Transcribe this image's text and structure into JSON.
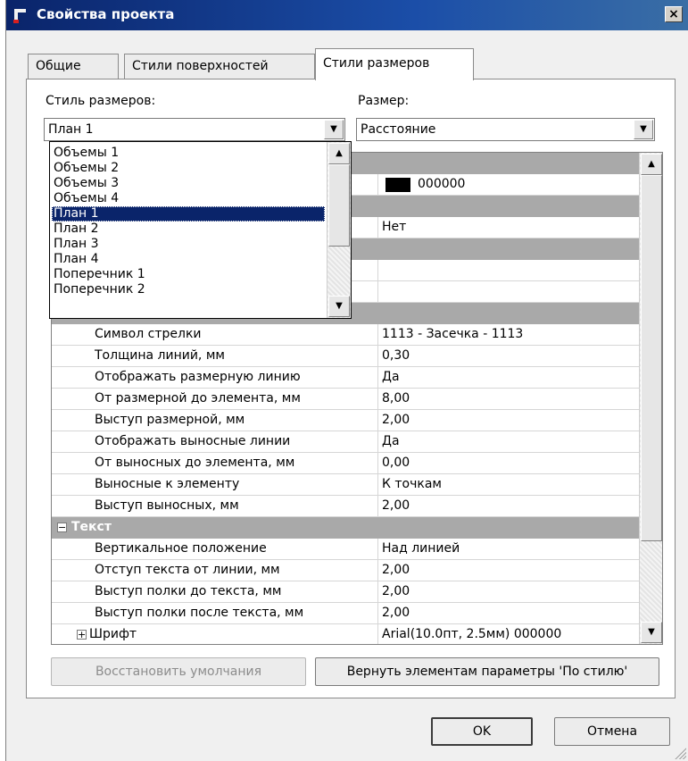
{
  "window": {
    "title": "Свойства проекта",
    "close_label": "×"
  },
  "tabs": [
    {
      "label": "Общие"
    },
    {
      "label": "Стили поверхностей"
    },
    {
      "label": "Стили размеров"
    }
  ],
  "dimension_style": {
    "label": "Стиль размеров:",
    "value": "План 1"
  },
  "dimension": {
    "label": "Размер:",
    "value": "Расстояние"
  },
  "dropdown": {
    "items": [
      "Объемы 1",
      "Объемы 2",
      "Объемы 3",
      "Объемы 4",
      "План 1",
      "План 2",
      "План 3",
      "План 4",
      "Поперечник 1",
      "Поперечник 2"
    ],
    "selected": "План 1"
  },
  "grid": {
    "color_swatch": "#000000",
    "color_value": "000000",
    "partial_value_net": "Нет",
    "rows_dim": [
      {
        "name": "Символ стрелки",
        "value": "1113 - Засечка - 1113"
      },
      {
        "name": "Толщина линий, мм",
        "value": "0,30"
      },
      {
        "name": "Отображать размерную линию",
        "value": "Да"
      },
      {
        "name": "От размерной до элемента, мм",
        "value": "8,00"
      },
      {
        "name": "Выступ размерной, мм",
        "value": "2,00"
      },
      {
        "name": "Отображать выносные линии",
        "value": "Да"
      },
      {
        "name": "От выносных до элемента, мм",
        "value": "0,00"
      },
      {
        "name": "Выносные к элементу",
        "value": "К точкам"
      },
      {
        "name": "Выступ выносных, мм",
        "value": "2,00"
      }
    ],
    "text_category": {
      "toggle": "−",
      "label": "Текст"
    },
    "rows_text": [
      {
        "name": "Вертикальное положение",
        "value": "Над линией"
      },
      {
        "name": "Отступ текста от линии, мм",
        "value": "2,00"
      },
      {
        "name": "Выступ полки до текста, мм",
        "value": "2,00"
      },
      {
        "name": "Выступ полки после текста, мм",
        "value": "2,00"
      }
    ],
    "font_row": {
      "toggle": "+",
      "name": "Шрифт",
      "value": "Arial(10.0пт, 2.5мм) 000000"
    }
  },
  "buttons": {
    "restore_defaults": "Восстановить умолчания",
    "reset_to_style": "Вернуть элементам параметры 'По стилю'",
    "ok": "OK",
    "cancel": "Отмена"
  },
  "icons": {
    "scroll_up": "▲",
    "scroll_down": "▼",
    "combo_arrow": "▼"
  }
}
